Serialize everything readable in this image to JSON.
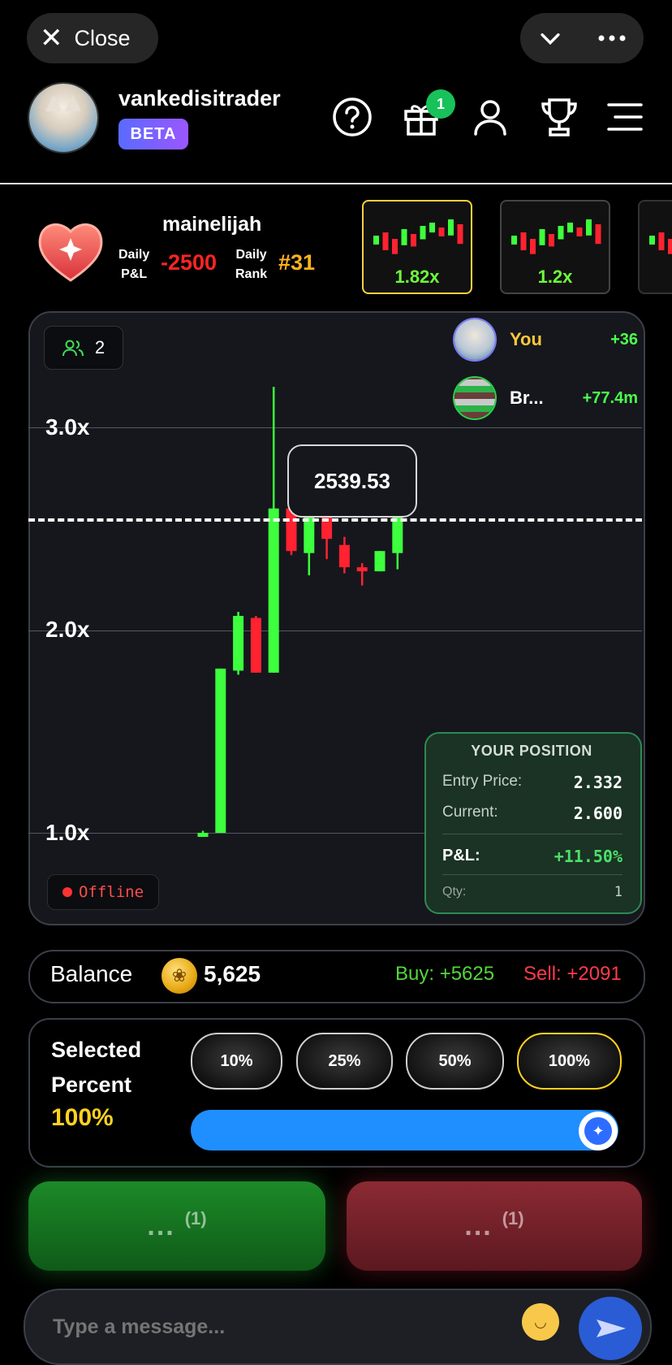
{
  "topbar": {
    "close_label": "Close",
    "close_icon": "close-icon",
    "menu_icons": [
      "chevron-down-icon",
      "more-icon"
    ]
  },
  "profile": {
    "username": "vankedisitrader",
    "badge": "BETA",
    "gift_count": "1"
  },
  "stats": {
    "opponent": "mainelijah",
    "pl_label_1": "Daily",
    "pl_label_2": "P&L",
    "pl_value": "-2500",
    "rank_label_1": "Daily",
    "rank_label_2": "Rank",
    "rank_value": "#31"
  },
  "mini_charts": [
    {
      "multiplier": "1.82x",
      "selected": true
    },
    {
      "multiplier": "1.2x",
      "selected": false
    }
  ],
  "chart": {
    "players_count": "2",
    "leaderboard": [
      {
        "name": "You",
        "score": "+36",
        "name_color": "#ffc83a"
      },
      {
        "name": "Br...",
        "score": "+77.4m",
        "name_color": "#ffffff"
      }
    ],
    "current_price": "2539.53",
    "status": "Offline"
  },
  "chart_data": {
    "type": "candlestick",
    "y_ticks": [
      "3.0x",
      "2.0x",
      "1.0x"
    ],
    "ylim": [
      1.0,
      3.0
    ],
    "current_multiplier": 2.6,
    "candles": [
      {
        "o": 1.0,
        "h": 1.01,
        "l": 0.99,
        "c": 1.0
      },
      {
        "o": 1.0,
        "h": 1.81,
        "l": 1.0,
        "c": 1.81
      },
      {
        "o": 1.8,
        "h": 2.09,
        "l": 1.78,
        "c": 2.07
      },
      {
        "o": 2.06,
        "h": 2.07,
        "l": 1.79,
        "c": 1.79
      },
      {
        "o": 1.79,
        "h": 3.2,
        "l": 1.79,
        "c": 2.6
      },
      {
        "o": 2.6,
        "h": 2.6,
        "l": 2.37,
        "c": 2.39
      },
      {
        "o": 2.38,
        "h": 2.62,
        "l": 2.27,
        "c": 2.6
      },
      {
        "o": 2.6,
        "h": 2.62,
        "l": 2.35,
        "c": 2.45
      },
      {
        "o": 2.42,
        "h": 2.46,
        "l": 2.28,
        "c": 2.31
      },
      {
        "o": 2.31,
        "h": 2.33,
        "l": 2.22,
        "c": 2.29
      },
      {
        "o": 2.29,
        "h": 2.39,
        "l": 2.29,
        "c": 2.39
      },
      {
        "o": 2.38,
        "h": 2.63,
        "l": 2.3,
        "c": 2.6
      }
    ]
  },
  "position": {
    "title": "YOUR POSITION",
    "entry_label": "Entry Price:",
    "entry_value": "2.332",
    "current_label": "Current:",
    "current_value": "2.600",
    "pl_label": "P&L:",
    "pl_value": "+11.50%",
    "qty_label": "Qty:",
    "qty_value": "1"
  },
  "balance": {
    "label": "Balance",
    "value": "5,625",
    "buy": "Buy: +5625",
    "sell": "Sell: +2091"
  },
  "percent": {
    "label_1": "Selected",
    "label_2": "Percent",
    "value": "100%",
    "options": [
      "10%",
      "25%",
      "50%",
      "100%"
    ],
    "selected_index": 3,
    "slider_fraction": 1.0
  },
  "actions": {
    "buy_label": "...",
    "buy_count": "(1)",
    "sell_label": "...",
    "sell_count": "(1)"
  },
  "message": {
    "placeholder": "Type a message..."
  },
  "colors": {
    "green": "#3dff3d",
    "red": "#ff2230",
    "accent_yellow": "#ffd21e",
    "slider_blue": "#1f8eff"
  }
}
